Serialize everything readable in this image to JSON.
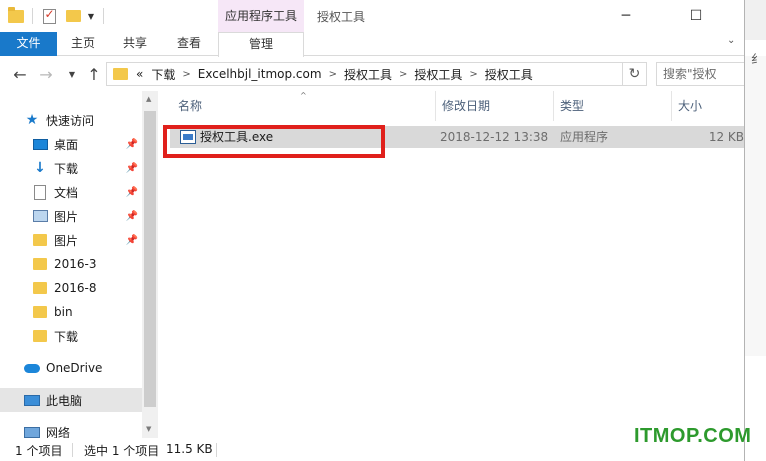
{
  "title_bar": {
    "context_tab_label": "应用程序工具",
    "window_title": "授权工具"
  },
  "ribbon": {
    "tabs": [
      "文件",
      "主页",
      "共享",
      "查看",
      "管理"
    ]
  },
  "address": {
    "overflow": "«",
    "crumbs": [
      "下载",
      "Excelhbjl_itmop.com",
      "授权工具",
      "授权工具",
      "授权工具"
    ],
    "search_placeholder": "搜索\"授权"
  },
  "nav": {
    "quick_access": "快速访问",
    "items": [
      "桌面",
      "下载",
      "文档",
      "图片",
      "图片",
      "2016-3",
      "2016-8",
      "bin",
      "下载"
    ],
    "onedrive": "OneDrive",
    "this_pc": "此电脑",
    "network": "网络"
  },
  "columns": [
    "名称",
    "修改日期",
    "类型",
    "大小"
  ],
  "files": [
    {
      "name": "授权工具.exe",
      "modified": "2018-12-12 13:38",
      "type": "应用程序",
      "size": "12 KB"
    }
  ],
  "right_window": {
    "char": "纟"
  },
  "status": {
    "count": "1 个项目",
    "selected": "选中 1 个项目",
    "size": "11.5 KB"
  },
  "watermark": "ITMOP.COM",
  "colors": {
    "accent": "#1979ca",
    "highlight_box": "#e0201b",
    "context_tab": "#f6e7f7"
  }
}
